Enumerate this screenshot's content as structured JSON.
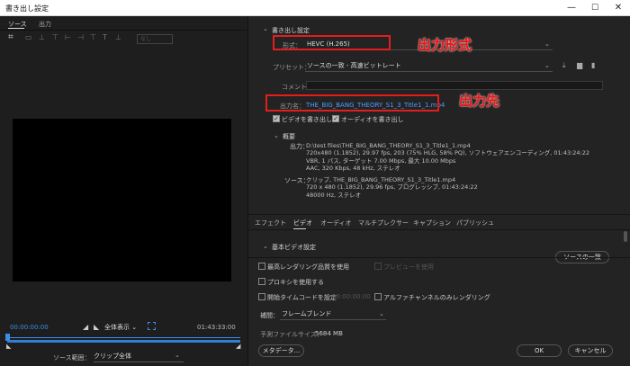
{
  "window": {
    "title": "書き出し設定",
    "min": "—",
    "max": "☐",
    "close": "✕"
  },
  "left": {
    "tabs": [
      "ソース",
      "出力"
    ],
    "codec_placeholder": "なし",
    "timecode_in": "00:00:00:00",
    "timecode_out": "01:43:33:00",
    "zoom": "全体表示",
    "source_range_label": "ソース範囲：",
    "source_range_value": "クリップ全体"
  },
  "export": {
    "section_title": "書き出し設定",
    "format_label": "形式：",
    "format_value": "HEVC (H.265)",
    "preset_label": "プリセット：",
    "preset_value": "ソースの一致 - 高速ビットレート",
    "comment_label": "コメント：",
    "output_name_label": "出力名：",
    "output_name_value": "THE_BIG_BANG_THEORY_S1_3_Title1_1.mp4",
    "export_video": "ビデオを書き出し",
    "export_audio": "オーディオを書き出し",
    "summary_title": "概要",
    "output_label": "出力：",
    "output_lines": [
      "D:\\test files\\THE_BIG_BANG_THEORY_S1_3_Title1_1.mp4",
      "720x480 (1.1852), 29.97 fps, 203 (75% HLG, 58% PQ), ソフトウェアエンコーディング, 01:43:24:22",
      "VBR, 1 パス, ターゲット 7.00 Mbps, 最大 10.00 Mbps",
      "AAC, 320 Kbps, 48 kHz, ステレオ"
    ],
    "source_label": "ソース：",
    "source_lines": [
      "クリップ, THE_BIG_BANG_THEORY_S1_3_Title1.mp4",
      "720 x 480 (1.1852), 29.96 fps, プログレッシブ, 01:43:24:22",
      "48000 Hz, ステレオ"
    ]
  },
  "annotations": {
    "format": "出力形式",
    "destination": "出力先"
  },
  "tabs": [
    "エフェクト",
    "ビデオ",
    "オーディオ",
    "マルチプレクサー",
    "キャプション",
    "パブリッシュ"
  ],
  "basic_video": {
    "title": "基本ビデオ設定",
    "match_source": "ソースの一致"
  },
  "options": {
    "max_render": "最高レンダリング品質を使用",
    "preview": "プレビューを使用",
    "proxy": "プロキシを使用する",
    "start_tc": "開始タイムコードを設定",
    "start_tc_value": "00:00:00:00",
    "alpha_only": "アルファチャンネルのみレンダリング",
    "interp_label": "補間：",
    "interp_value": "フレームブレンド",
    "est_size_label": "予測ファイルサイズ：",
    "est_size_value": "5684 MB",
    "metadata_button": "メタデータ...",
    "ok_button": "OK",
    "cancel_button": "キャンセル"
  },
  "colors": {
    "accent": "#3a8ee6",
    "annotation": "#e41d1d",
    "link": "#4a9eff"
  }
}
